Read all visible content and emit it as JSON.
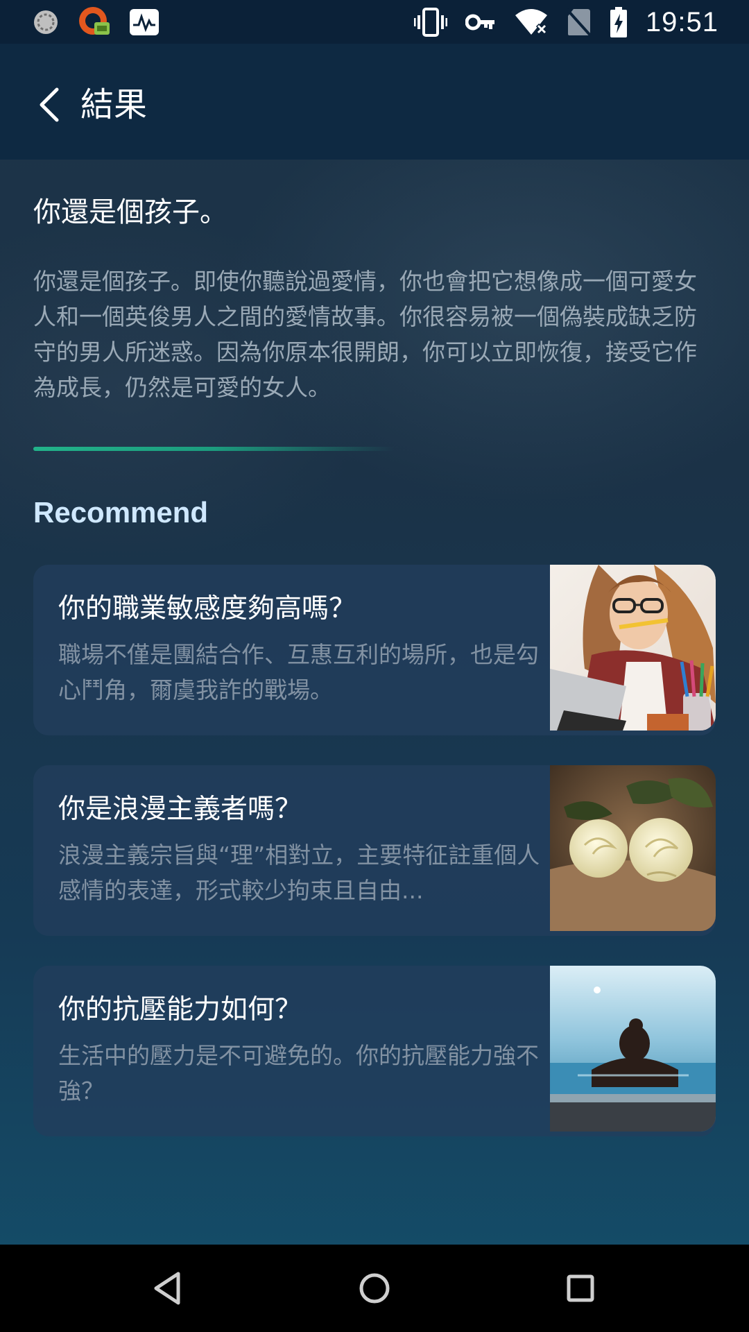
{
  "status_bar": {
    "time": "19:51",
    "left_icons": [
      "sync-icon",
      "vpn-app-icon",
      "activity-monitor-icon"
    ],
    "right_icons": [
      "vibrate-icon",
      "key-icon",
      "wifi-off-icon",
      "no-sim-icon",
      "battery-charging-icon"
    ]
  },
  "app_bar": {
    "back_icon": "back-arrow-icon",
    "title": "結果"
  },
  "result": {
    "title": "你還是個孩子。",
    "body": "你還是個孩子。即使你聽說過愛情，你也會把它想像成一個可愛女人和一個英俊男人之間的愛情故事。你很容易被一個偽裝成缺乏防守的男人所迷惑。因為你原本很開朗，你可以立即恢復，接受它作為成長，仍然是可愛的女人。"
  },
  "recommend": {
    "heading": "Recommend",
    "cards": [
      {
        "title": "你的職業敏感度夠高嗎？",
        "description": "職場不僅是團結合作、互惠互利的場所，也是勾心鬥角，爾虞我詐的戰場。",
        "image": "woman-at-laptop-photo"
      },
      {
        "title": "你是浪漫主義者嗎？",
        "description": "浪漫主義宗旨與“理”相對立，主要特征註重個人感情的表達，形式較少拘束且自由...",
        "image": "white-roses-photo"
      },
      {
        "title": "你的抗壓能力如何？",
        "description": "生活中的壓力是不可避免的。你的抗壓能力強不強？",
        "image": "woman-in-infinity-pool-photo"
      }
    ]
  },
  "nav_bar": {
    "buttons": [
      "back-triangle-icon",
      "home-circle-icon",
      "recents-square-icon"
    ]
  },
  "colors": {
    "accent": "#22b38a",
    "heading": "#cfe8ff",
    "status_bar": "#0b2138",
    "app_bar": "#0e2942"
  }
}
